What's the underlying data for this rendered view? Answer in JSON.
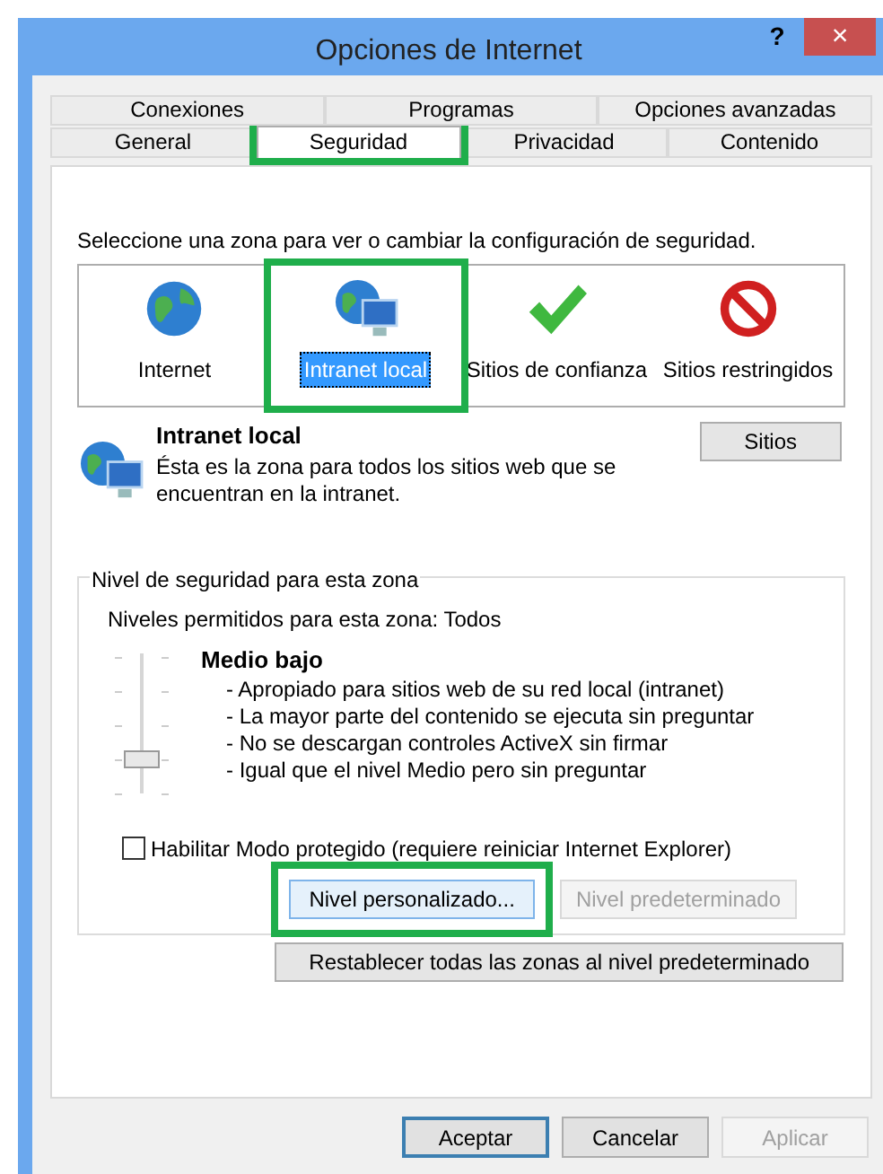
{
  "window": {
    "title": "Opciones de Internet",
    "help": "?",
    "close": "×"
  },
  "tab_rows": [
    [
      {
        "label": "Conexiones",
        "selected": false,
        "highlighted": false
      },
      {
        "label": "Programas",
        "selected": false,
        "highlighted": false
      },
      {
        "label": "Opciones avanzadas",
        "selected": false,
        "highlighted": false
      }
    ],
    [
      {
        "label": "General",
        "selected": false,
        "highlighted": false
      },
      {
        "label": "Seguridad",
        "selected": true,
        "highlighted": true
      },
      {
        "label": "Privacidad",
        "selected": false,
        "highlighted": false
      },
      {
        "label": "Contenido",
        "selected": false,
        "highlighted": false
      }
    ]
  ],
  "instruction": "Seleccione una zona para ver o cambiar la configuración de seguridad.",
  "zones": [
    {
      "label": "Internet",
      "kind": "globe",
      "selected": false,
      "highlighted": false
    },
    {
      "label": "Intranet local",
      "kind": "intranet",
      "selected": true,
      "highlighted": true
    },
    {
      "label": "Sitios de confianza",
      "kind": "trusted",
      "selected": false,
      "highlighted": false
    },
    {
      "label": "Sitios restringidos",
      "kind": "restricted",
      "selected": false,
      "highlighted": false
    }
  ],
  "zone_info": {
    "title": "Intranet local",
    "description": "Ésta es la zona para todos los sitios web que se encuentran en la intranet.",
    "button": "Sitios"
  },
  "security_level": {
    "legend": "Nivel de seguridad para esta zona",
    "allowed": "Niveles permitidos para esta zona: Todos",
    "level_name": "Medio bajo",
    "level": 0.25,
    "bullets": [
      "- Apropiado para sitios web de su red local (intranet)",
      "- La mayor parte del contenido se ejecuta sin preguntar",
      "- No se descargan controles ActiveX sin firmar",
      "- Igual que el nivel Medio pero sin preguntar"
    ],
    "protected_mode": {
      "label": "Habilitar Modo protegido (requiere reiniciar Internet Explorer)",
      "checked": false
    },
    "buttons": [
      {
        "label": "Nivel personalizado...",
        "disabled": false,
        "highlighted": true
      },
      {
        "label": "Nivel predeterminado",
        "disabled": true,
        "highlighted": false
      }
    ]
  },
  "reset_button": "Restablecer todas las zonas al nivel predeterminado",
  "footer_buttons": [
    {
      "label": "Aceptar",
      "disabled": false,
      "default": true
    },
    {
      "label": "Cancelar",
      "disabled": false,
      "default": false
    },
    {
      "label": "Aplicar",
      "disabled": true,
      "default": false
    }
  ]
}
